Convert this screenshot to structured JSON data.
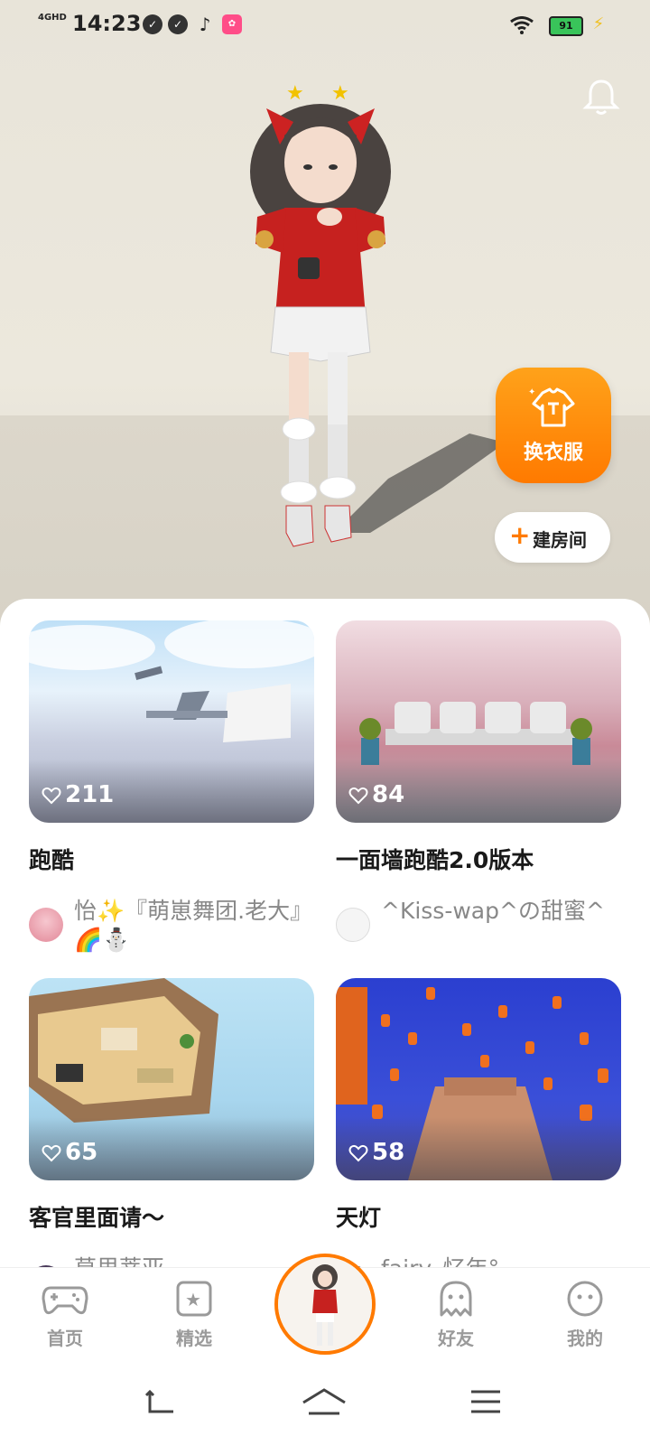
{
  "status_bar": {
    "time": "14:23",
    "network": "4GHD",
    "battery": "91"
  },
  "actions": {
    "change_outfit_label": "换衣服",
    "create_room_label": "建房间"
  },
  "rooms": [
    {
      "likes": "211",
      "title": "跑酷",
      "author": "怡✨『萌崽舞团.老大』🌈⛄"
    },
    {
      "likes": "84",
      "title": "一面墙跑酷2.0版本",
      "author": "^Kiss-wap^の甜蜜^"
    },
    {
      "likes": "65",
      "title": "客官里面请～",
      "author": "莫里蒂亚"
    },
    {
      "likes": "58",
      "title": "天灯",
      "author": "fairy_忆年°"
    }
  ],
  "tabs": {
    "home": "首页",
    "featured": "精选",
    "friends": "好友",
    "mine": "我的"
  },
  "colors": {
    "accent": "#ff7a00",
    "tab_inactive": "#9a9a9a"
  }
}
